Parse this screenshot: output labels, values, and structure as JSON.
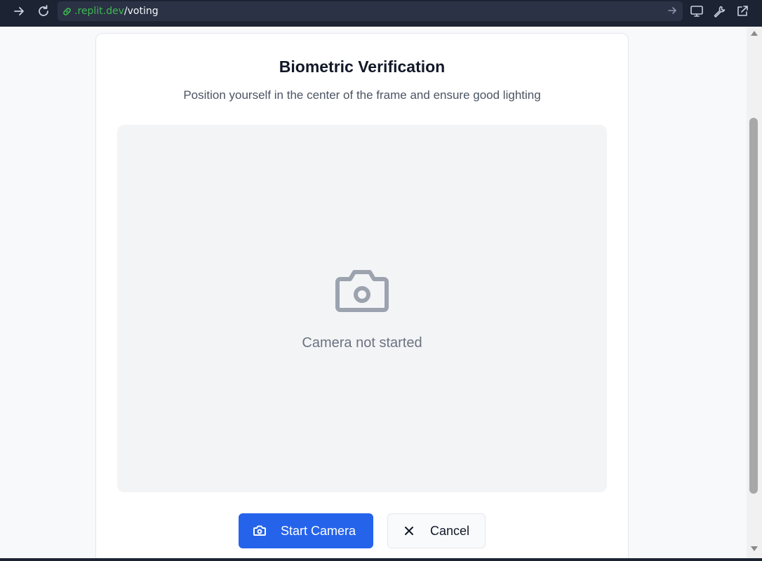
{
  "browser": {
    "url_domain": ".replit.dev",
    "url_path": "/voting",
    "icons": [
      "forward-icon",
      "reload-icon",
      "link-icon",
      "go-icon",
      "monitor-icon",
      "wrench-icon",
      "external-link-icon"
    ]
  },
  "verification": {
    "title": "Biometric Verification",
    "subtitle": "Position yourself in the center of the frame and ensure good lighting",
    "camera_status": "Camera not started",
    "start_label": "Start Camera",
    "cancel_label": "Cancel"
  },
  "colors": {
    "primary": "#2563eb",
    "topbar": "#1c2333",
    "url_domain": "#3fb950",
    "camera_bg": "#f3f4f6",
    "icon_gray": "#9ca3af"
  }
}
